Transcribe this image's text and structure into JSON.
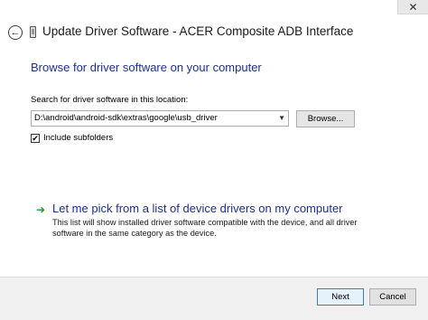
{
  "titlebar": {
    "title": "Update Driver Software - ACER Composite ADB Interface",
    "close_icon": "close-icon",
    "back_icon": "back-arrow-icon",
    "device_icon": "device-icon"
  },
  "content": {
    "heading": "Browse for driver software on your computer",
    "search_label": "Search for driver software in this location:",
    "path_value": "D:\\android\\android-sdk\\extras\\google\\usb_driver",
    "browse_label": "Browse...",
    "include_subfolders_label": "Include subfolders",
    "include_subfolders_checked": true,
    "pick_option_title": "Let me pick from a list of device drivers on my computer",
    "pick_option_desc": "This list will show installed driver software compatible with the device, and all driver software in the same category as the device."
  },
  "footer": {
    "next_label": "Next",
    "cancel_label": "Cancel"
  },
  "colors": {
    "heading": "#1e3287",
    "arrow": "#1a9a3a"
  }
}
